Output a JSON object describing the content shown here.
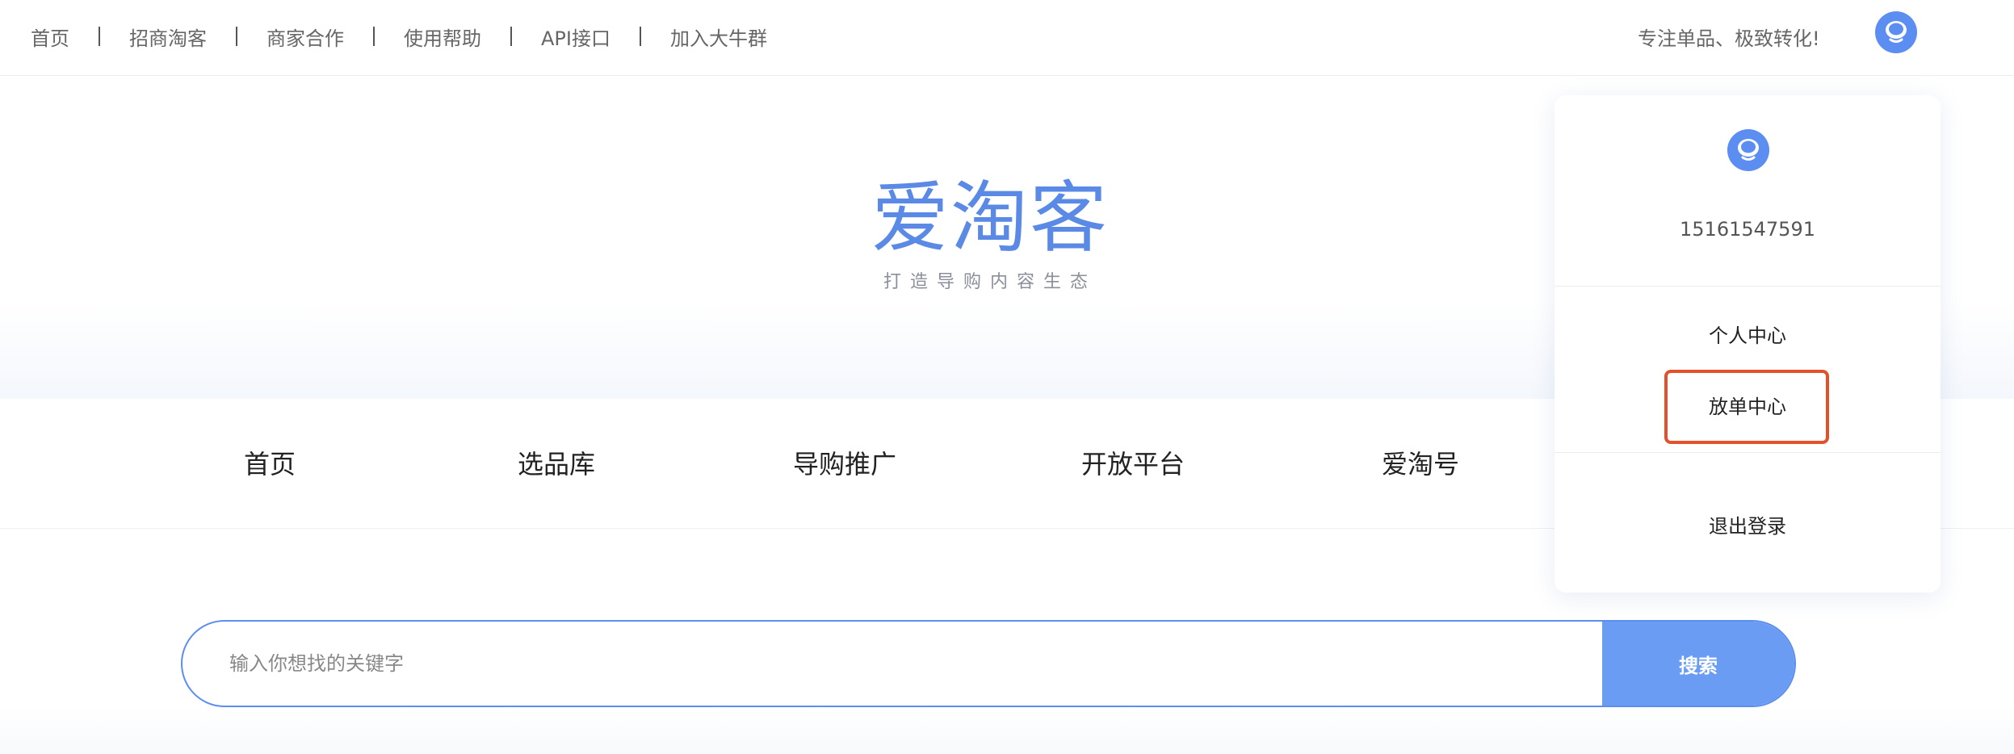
{
  "topnav": {
    "links": [
      "首页",
      "招商淘客",
      "商家合作",
      "使用帮助",
      "API接口",
      "加入大牛群"
    ],
    "slogan": "专注单品、极致转化!"
  },
  "logo": {
    "title": "爱淘客",
    "subtitle": "打造导购内容生态"
  },
  "main_nav": {
    "items": [
      "首页",
      "选品库",
      "导购推广",
      "开放平台",
      "爱淘号"
    ]
  },
  "search": {
    "placeholder": "输入你想找的关键字",
    "value": "",
    "button_label": "搜索"
  },
  "user_menu": {
    "phone": "15161547591",
    "items": [
      "个人中心",
      "放单中心",
      "退出登录"
    ],
    "highlighted_item": "放单中心"
  },
  "colors": {
    "accent": "#5a8ae6",
    "search_button": "#6a9cf3",
    "highlight_border": "#e3512b",
    "avatar": "#5b8ef0"
  },
  "icons": {
    "avatar": "user-avatar-icon"
  }
}
